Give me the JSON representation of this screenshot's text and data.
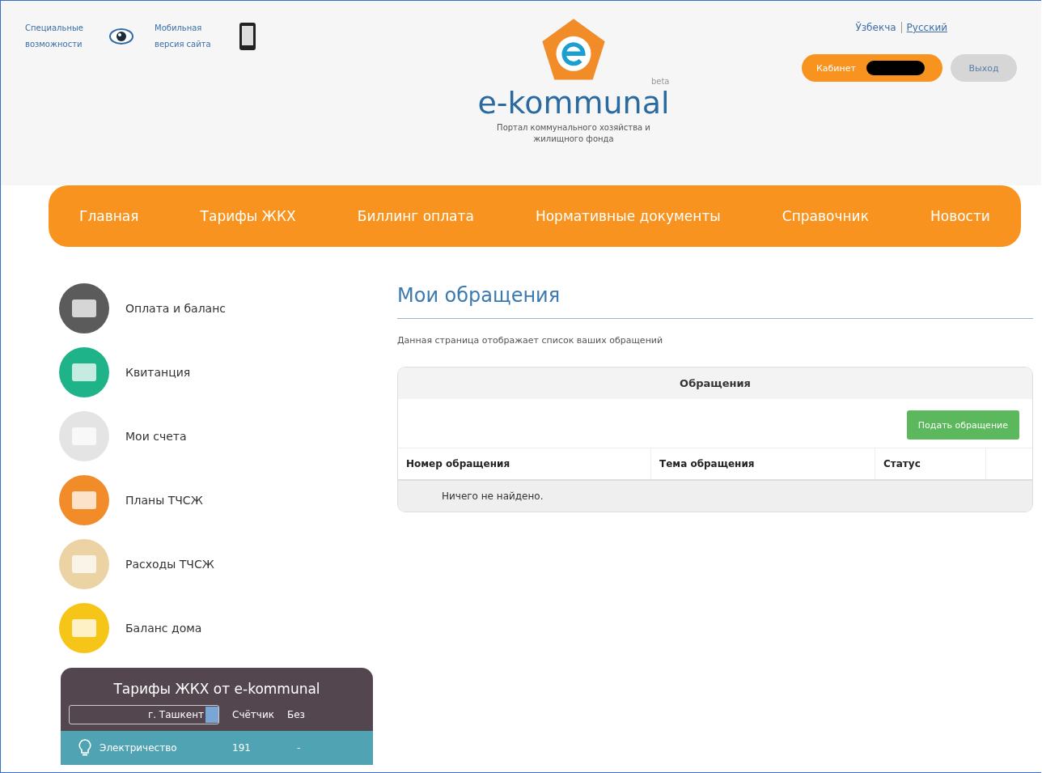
{
  "header": {
    "accessibility_link": "Специальные возможности",
    "mobile_link": "Мобильная версия сайта",
    "logo_text": "e-kommunal",
    "logo_badge": "beta",
    "tagline": "Портал коммунального хозяйства и жилищного фонда",
    "languages": [
      {
        "label": "Ўзбекча",
        "selected": false
      },
      {
        "label": "Русский",
        "selected": true
      }
    ],
    "cabinet_button": "Кабинет",
    "logout_button": "Выход"
  },
  "nav": [
    {
      "label": "Главная"
    },
    {
      "label": "Тарифы ЖКХ"
    },
    {
      "label": "Биллинг оплата"
    },
    {
      "label": "Нормативные документы"
    },
    {
      "label": "Справочник"
    },
    {
      "label": "Новости"
    }
  ],
  "sidebar": {
    "items": [
      {
        "label": "Оплата и баланс",
        "color": "#5b5b5b"
      },
      {
        "label": "Квитанция",
        "color": "#1fb38a"
      },
      {
        "label": "Мои счета",
        "color": "#e4e4e4"
      },
      {
        "label": "Планы ТЧСЖ",
        "color": "#f28c28"
      },
      {
        "label": "Расходы ТЧСЖ",
        "color": "#ecd3a4"
      },
      {
        "label": "Баланс дома",
        "color": "#f5c518"
      }
    ],
    "tariffs": {
      "title": "Тарифы ЖКХ от e-kommunal",
      "city": "г. Ташкент",
      "columns": [
        "Счётчик",
        "Без"
      ],
      "rows": [
        {
          "name": "Электричество",
          "meter": "191",
          "without": "-"
        }
      ]
    }
  },
  "main": {
    "title": "Мои обращения",
    "description": "Данная страница отображает список ваших обращений",
    "panel": {
      "title": "Обращения",
      "submit_button": "Подать обращение",
      "columns": [
        "Номер обращения",
        "Тема обращения",
        "Статус"
      ],
      "empty_message": "Ничего не найдено."
    }
  }
}
